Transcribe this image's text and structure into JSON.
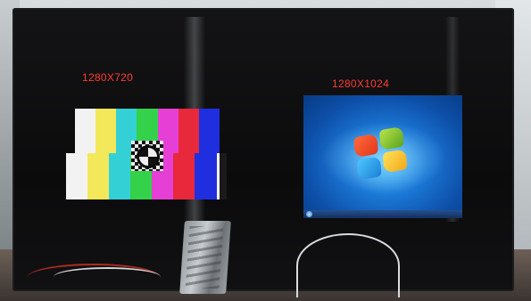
{
  "labels": {
    "left_resolution": "1280X720",
    "right_resolution": "1280X1024"
  },
  "colors": {
    "label": "#ff3b30",
    "test_bars_top": [
      "#f2f2f2",
      "#f3e85a",
      "#33d1d6",
      "#33d24a",
      "#e63fd6",
      "#e8283b",
      "#1f2fe0"
    ],
    "test_bars_bottom": [
      "#f2f2f2",
      "#f3e85a",
      "#33d1d6",
      "#33d24a",
      "#e63fd6",
      "#e8283b",
      "#1f2fe0"
    ]
  },
  "icons": {
    "windows_logo": "windows-logo-icon",
    "test_target": "crosshair-test-target-icon"
  }
}
